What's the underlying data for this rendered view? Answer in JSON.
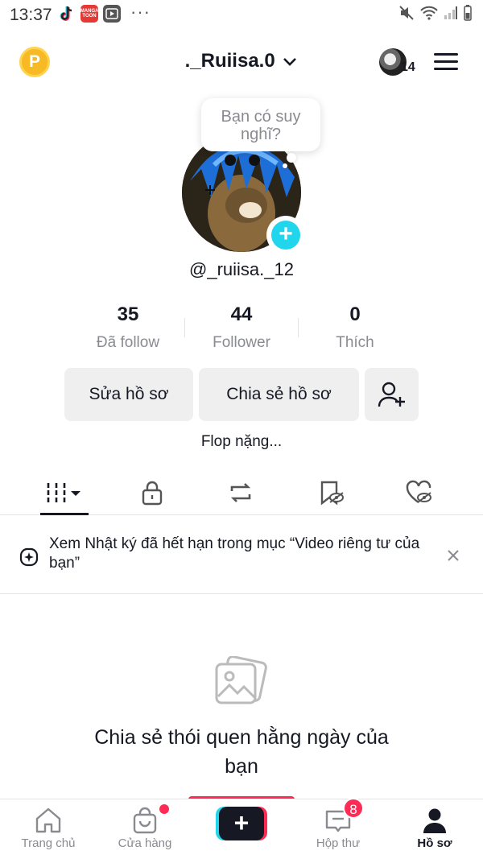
{
  "status_bar": {
    "time": "13:37",
    "manga_label": "MANGA TOON",
    "dots": "···"
  },
  "header": {
    "username": "._Ruiisa.0",
    "profile_views_count": "14"
  },
  "profile": {
    "thought_bubble": "Bạn có suy nghĩ?",
    "handle": "@_ruiisa._12",
    "bio": "Flop nặng..."
  },
  "stats": [
    {
      "value": "35",
      "label": "Đã follow"
    },
    {
      "value": "44",
      "label": "Follower"
    },
    {
      "value": "0",
      "label": "Thích"
    }
  ],
  "actions": {
    "edit_profile": "Sửa hồ sơ",
    "share_profile": "Chia sẻ hồ sơ"
  },
  "tabs": [
    "videos-grid",
    "private",
    "reposts",
    "favorites",
    "liked"
  ],
  "banner": {
    "text": "Xem Nhật ký đã hết hạn trong mục “Video riêng tư của bạn”"
  },
  "empty_state": {
    "title": "Chia sẻ thói quen hằng ngày của bạn"
  },
  "bottom_nav": {
    "home": "Trang chủ",
    "shop": "Cửa hàng",
    "inbox": "Hộp thư",
    "inbox_badge": "8",
    "profile": "Hồ sơ"
  },
  "colors": {
    "accent_red": "#fe2c55",
    "accent_cyan": "#20d5ec",
    "text_primary": "#161823",
    "text_secondary": "#8a8b91"
  }
}
